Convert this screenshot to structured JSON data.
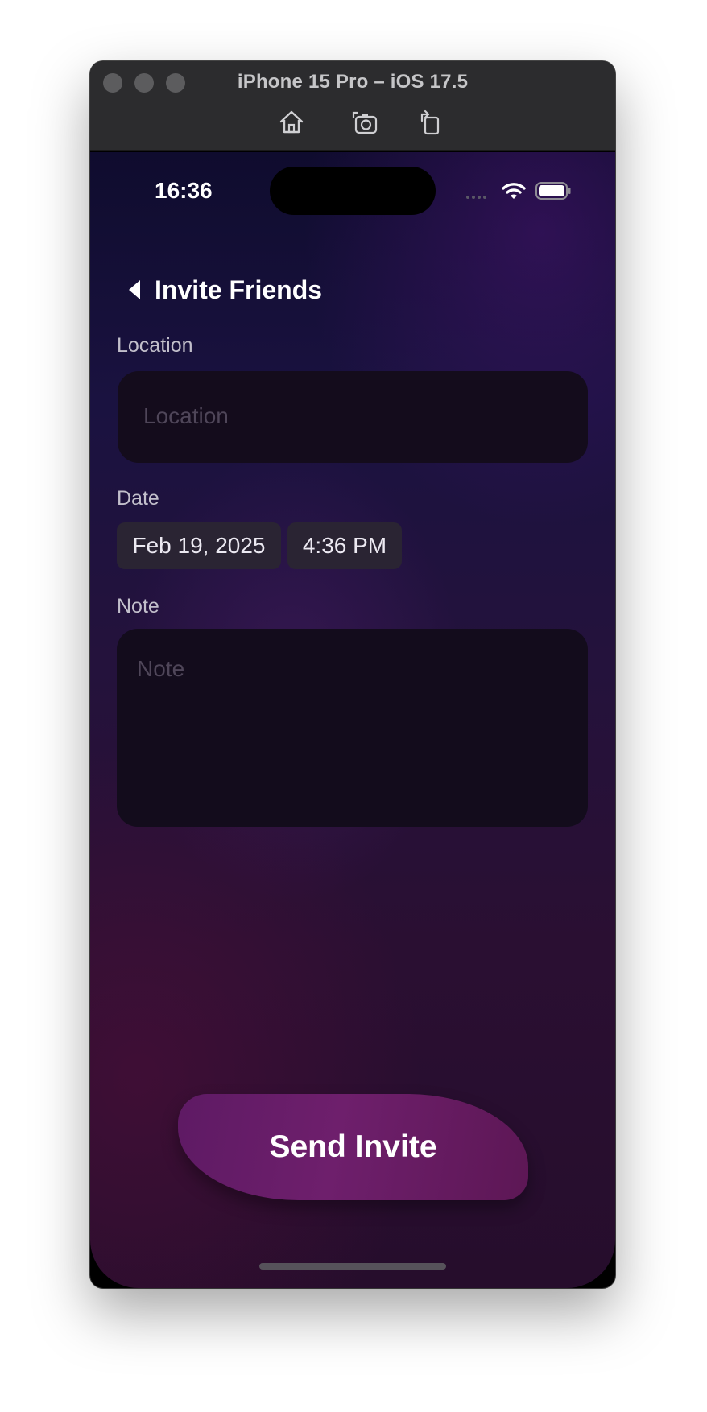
{
  "window": {
    "title": "iPhone 15 Pro – iOS 17.5",
    "toolbar_icons": [
      "home-icon",
      "screenshot-icon",
      "rotate-icon"
    ]
  },
  "status_bar": {
    "time": "16:36",
    "icons": [
      "cellular-signal-icon",
      "wifi-icon",
      "battery-icon"
    ]
  },
  "nav": {
    "back_icon": "chevron-left-icon",
    "title": "Invite Friends"
  },
  "form": {
    "location": {
      "label": "Location",
      "placeholder": "Location",
      "value": ""
    },
    "date": {
      "label": "Date",
      "date_value": "Feb 19, 2025",
      "time_value": "4:36 PM"
    },
    "note": {
      "label": "Note",
      "placeholder": "Note",
      "value": ""
    }
  },
  "actions": {
    "send_label": "Send Invite"
  },
  "colors": {
    "accent": "#6a1e68",
    "field_bg": "#140c1c",
    "background_top": "#0f0c2e",
    "background_bottom": "#260d2c"
  }
}
